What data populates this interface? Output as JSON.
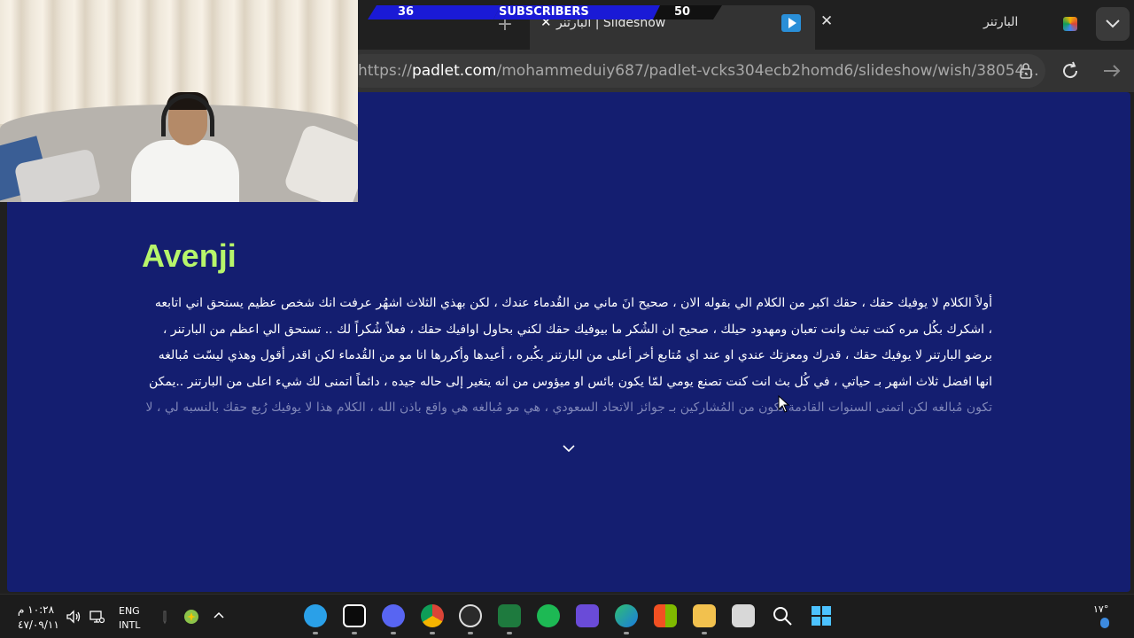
{
  "subscribers": {
    "left_count": "36",
    "label": "SUBSCRIBERS",
    "right_count": "50"
  },
  "browser": {
    "inactive_tab_symbol": "+",
    "active_tab": {
      "close_symbol": "✕",
      "title": "البارتنر | Slideshow"
    },
    "second_tab": {
      "close_symbol": "✕",
      "title": "البارتنر"
    },
    "tab_list_symbol": "⌄",
    "url": {
      "prefix": "https://",
      "domain": "padlet.com",
      "path": "/mohammeduiy687/padlet-vcks304ecb2homd6/slideshow/wish/38054..."
    }
  },
  "post": {
    "title": "Avenji",
    "lines": [
      "أولاً الكلام لا يوفيك حقك ، حقك اكبر من الكلام الي بقوله الان ، صحيح انَ ماني من القُدماء عندك ، لكن بهذي الثلاث اشهُر عرفت انك شخص عظيم يستحق اني اتابعه",
      "، اشكرك بكُل مره كنت تبث وانت تعبان ومهدود حيلك ، صحيح ان الشُكر ما بيوفيك حقك لكني بحاول اوافيك حقك ، فعلاً شُكراً لك .. تستحق الي اعظم من البارتنر ،",
      "برضو البارتنر لا يوفيك حقك ، قدرك ومعزتك عندي او عند اي مُتابع أخر أعلى من البارتنر بكُبره ، أعيدها وأكررها انا مو من القُدماء لكن اقدر أقول وهذي ليسّت مُبالغه",
      "انها افضل ثلاث اشهر بـ حياتي ، في كُل بث انت كنت تصنع يومي لمّا يكون بائس او ميؤوس من انه يتغير إلى حاله جيده ، دائماً اتمنى لك شيء اعلى من البارتنر ..يمكن",
      "تكون مُبالغه لكن اتمنى السنوات القادمة تكون من المُشاركين بـ جوائز الاتحاد السعودي ، هي مو مُبالغه هي واقع باذن الله ، الكلام هذا لا يوفيك رُبع حقك بالنسبه لي ، لا"
    ]
  },
  "taskbar": {
    "time": "١٠:٢٨ م",
    "date": "٤٧/٠٩/١١",
    "lang_line1": "ENG",
    "lang_line2": "INTL",
    "tray_chevron": "^",
    "weather": "١٧°"
  }
}
